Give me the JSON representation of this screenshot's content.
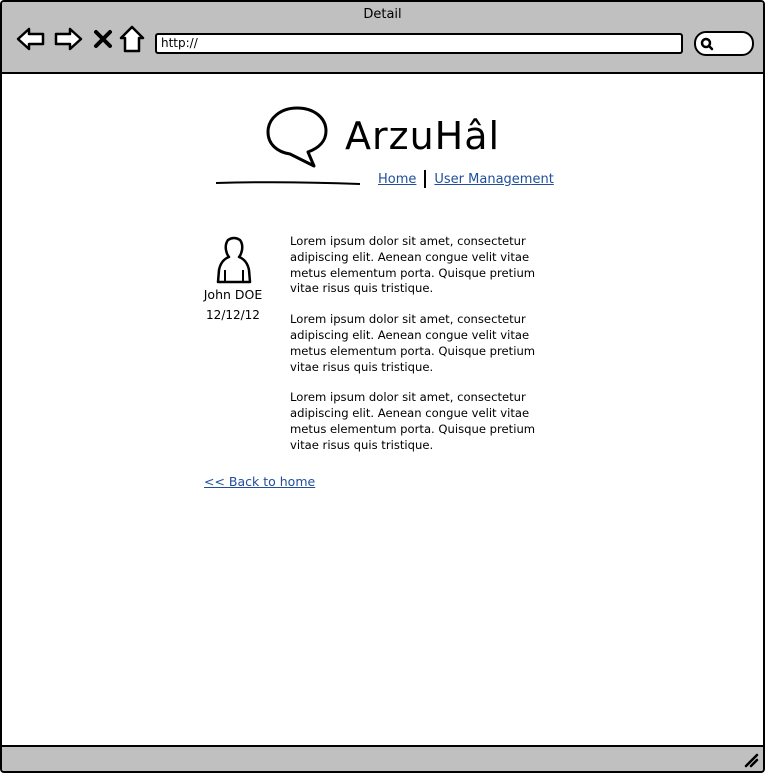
{
  "window": {
    "title": "Detail"
  },
  "browser": {
    "url": "http://",
    "buttons": [
      "back",
      "forward",
      "stop",
      "home"
    ]
  },
  "header": {
    "logo_text": "ArzuHâl",
    "nav": [
      {
        "label": "Home"
      },
      {
        "label": "User Management"
      }
    ]
  },
  "profile": {
    "name": "John DOE",
    "date": "12/12/12"
  },
  "body": {
    "paragraphs": [
      "Lorem ipsum dolor sit amet, consectetur adipiscing elit. Aenean congue velit vitae metus elementum porta. Quisque pretium vitae risus quis tristique.",
      "Lorem ipsum dolor sit amet, consectetur adipiscing elit. Aenean congue velit vitae metus elementum porta. Quisque pretium vitae risus quis tristique.",
      "Lorem ipsum dolor sit amet, consectetur adipiscing elit. Aenean congue velit vitae metus elementum porta. Quisque pretium vitae risus quis tristique."
    ]
  },
  "footer": {
    "back_link": "<< Back to home"
  },
  "colors": {
    "chrome": "#c0c0c0",
    "link": "#1f4e9a"
  }
}
